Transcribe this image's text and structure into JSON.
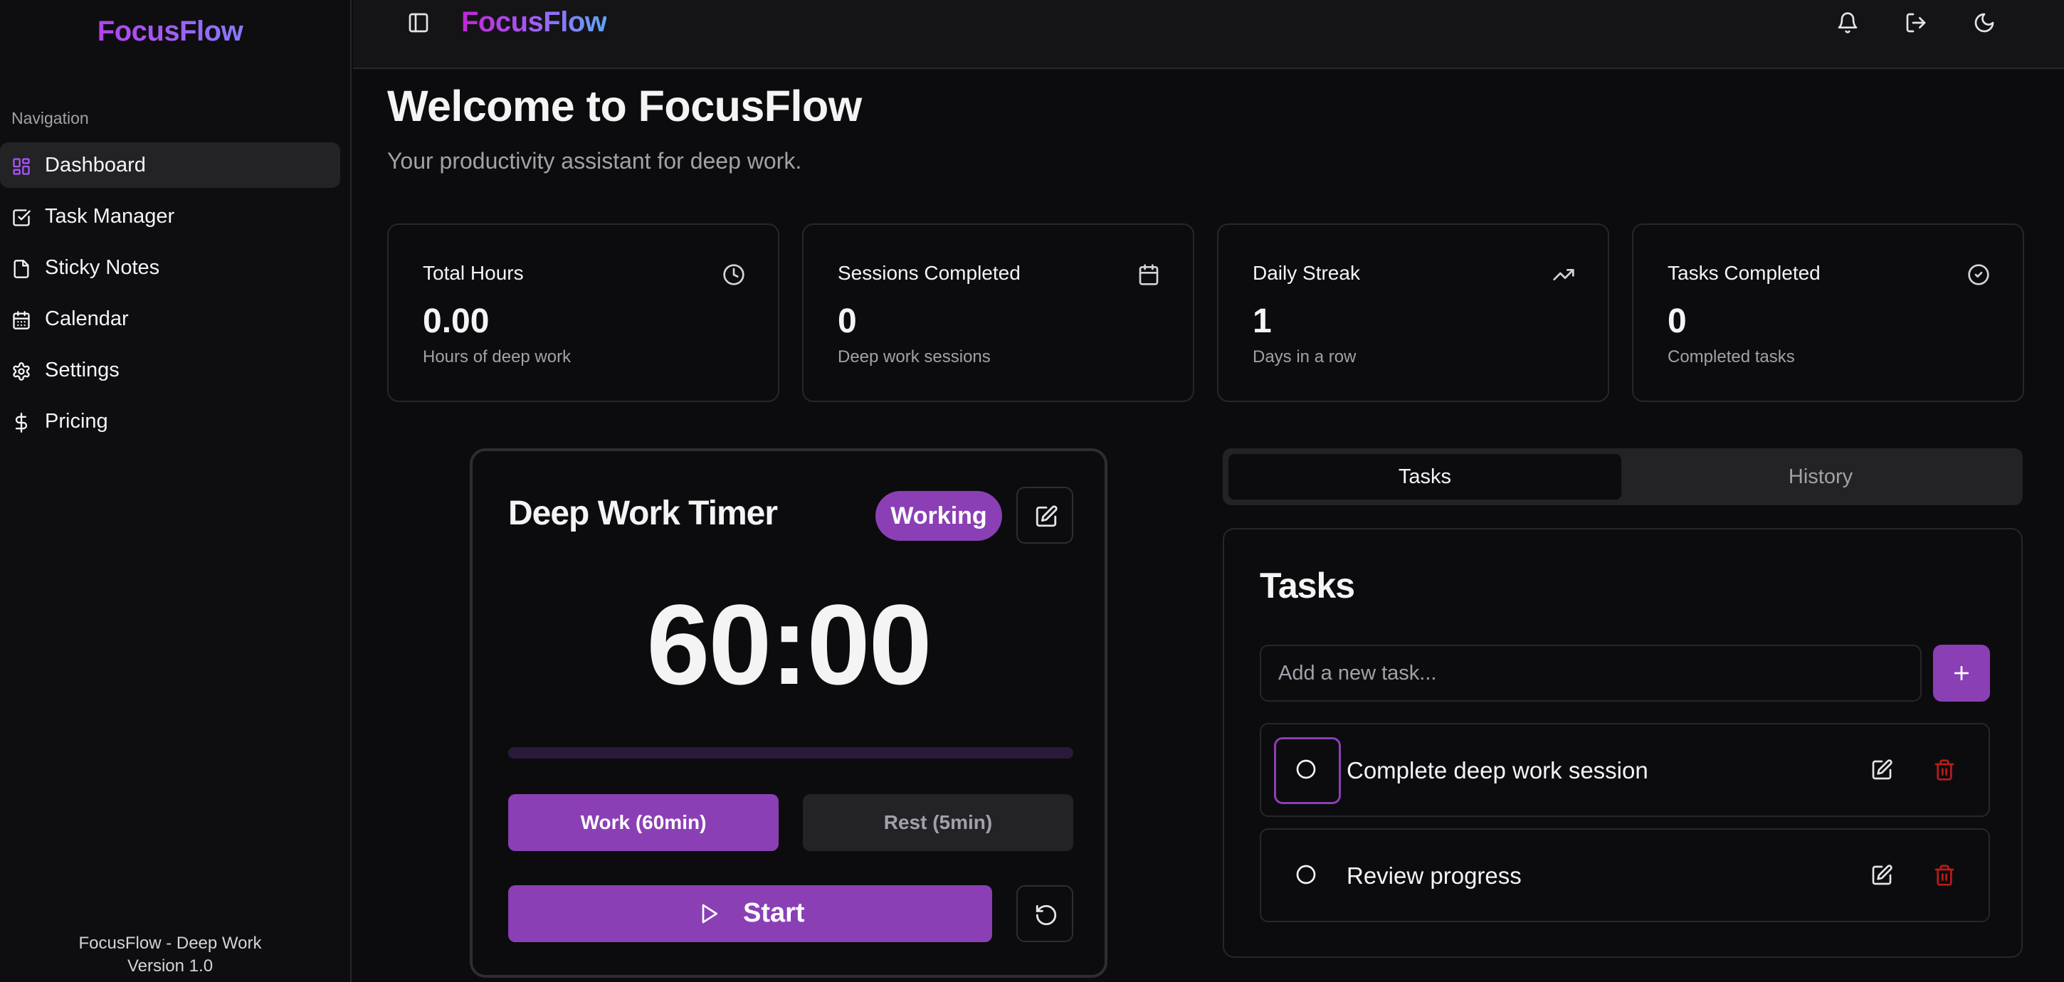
{
  "app": {
    "name": "FocusFlow",
    "footer_line1": "FocusFlow - Deep Work",
    "footer_line2": "Version 1.0"
  },
  "colors": {
    "accent": "#8b3fb5",
    "background": "#0c0c0e",
    "border": "#27272a",
    "muted_text": "#a1a1aa",
    "danger": "#b91c1c",
    "brand_gradient": [
      "#c026d3",
      "#a855f7",
      "#60a5fa"
    ]
  },
  "sidebar": {
    "heading": "Navigation",
    "items": [
      {
        "label": "Dashboard",
        "icon": "dashboard-icon",
        "active": true
      },
      {
        "label": "Task Manager",
        "icon": "checkbox-icon",
        "active": false
      },
      {
        "label": "Sticky Notes",
        "icon": "note-icon",
        "active": false
      },
      {
        "label": "Calendar",
        "icon": "calendar-icon",
        "active": false
      },
      {
        "label": "Settings",
        "icon": "gear-icon",
        "active": false
      },
      {
        "label": "Pricing",
        "icon": "dollar-icon",
        "active": false
      }
    ]
  },
  "topbar": {
    "icons": [
      "sidebar-toggle-icon",
      "bell-icon",
      "logout-icon",
      "moon-icon"
    ]
  },
  "main": {
    "title": "Welcome to FocusFlow",
    "subtitle": "Your productivity assistant for deep work."
  },
  "stats": [
    {
      "title": "Total Hours",
      "value": "0.00",
      "desc": "Hours of deep work",
      "icon": "clock-icon"
    },
    {
      "title": "Sessions Completed",
      "value": "0",
      "desc": "Deep work sessions",
      "icon": "calendar-icon"
    },
    {
      "title": "Daily Streak",
      "value": "1",
      "desc": "Days in a row",
      "icon": "trending-up-icon"
    },
    {
      "title": "Tasks Completed",
      "value": "0",
      "desc": "Completed tasks",
      "icon": "check-circle-icon"
    }
  ],
  "timer": {
    "title": "Deep Work Timer",
    "status": "Working",
    "display": "60:00",
    "progress": 0,
    "work_label": "Work (60min)",
    "rest_label": "Rest (5min)",
    "active_mode": "work",
    "start_label": "Start"
  },
  "tabs": [
    {
      "label": "Tasks",
      "active": true
    },
    {
      "label": "History",
      "active": false
    }
  ],
  "tasks": {
    "title": "Tasks",
    "input_placeholder": "Add a new task...",
    "input_value": "",
    "items": [
      {
        "label": "Complete deep work session",
        "done": false,
        "focused": true
      },
      {
        "label": "Review progress",
        "done": false,
        "focused": false
      }
    ]
  }
}
